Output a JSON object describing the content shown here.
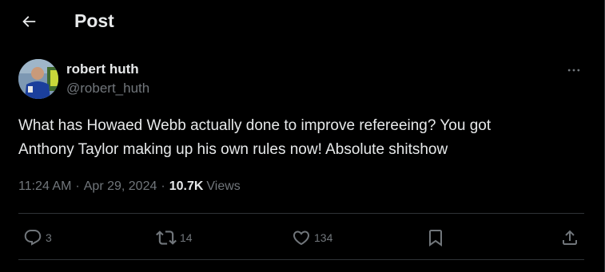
{
  "header": {
    "title": "Post",
    "back_icon": "arrow-left-icon"
  },
  "author": {
    "name": "robert huth",
    "handle": "@robert_huth",
    "avatar_icon": "avatar"
  },
  "post": {
    "text": "What has Howaed Webb actually done to improve refereeing? You got\nAnthony Taylor making up his own rules now! Absolute shitshow",
    "time": "11:24 AM",
    "date": "Apr 29, 2024",
    "views_count": "10.7K",
    "views_label": "Views"
  },
  "actions": {
    "reply_count": "3",
    "repost_count": "14",
    "like_count": "134"
  },
  "colors": {
    "background": "#000000",
    "text_primary": "#e7e9ea",
    "text_secondary": "#71767b",
    "border": "#2f3336"
  }
}
